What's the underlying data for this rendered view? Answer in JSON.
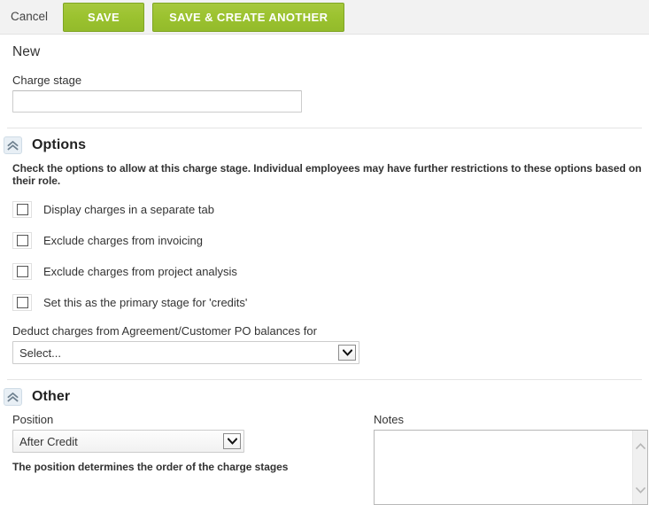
{
  "toolbar": {
    "cancel_label": "Cancel",
    "save_label": "SAVE",
    "save_create_another_label": "SAVE & CREATE ANOTHER",
    "accent_green": "#9dc437",
    "background": "#f2f2f2"
  },
  "page": {
    "title": "New"
  },
  "charge_stage": {
    "label": "Charge stage",
    "value": "",
    "placeholder": ""
  },
  "options_section": {
    "title": "Options",
    "collapse_icon": "double-chevron-up-icon",
    "description": "Check the options to allow at this charge stage. Individual employees may have further restrictions to these options based on their role.",
    "checkboxes": [
      {
        "label": "Display charges in a separate tab",
        "checked": false
      },
      {
        "label": "Exclude charges from invoicing",
        "checked": false
      },
      {
        "label": "Exclude charges from project analysis",
        "checked": false
      },
      {
        "label": "Set this as the primary stage for 'credits'",
        "checked": false
      }
    ],
    "deduct": {
      "label": "Deduct charges from Agreement/Customer PO balances for",
      "value": "Select...",
      "arrow_icon": "chevron-down-icon"
    }
  },
  "other_section": {
    "title": "Other",
    "collapse_icon": "double-chevron-up-icon",
    "position": {
      "label": "Position",
      "value": "After Credit",
      "arrow_icon": "chevron-down-icon",
      "hint": "The position determines the order of the charge stages"
    },
    "notes": {
      "label": "Notes",
      "value": "",
      "placeholder": "",
      "scroll_up_icon": "chevron-up-icon",
      "scroll_down_icon": "chevron-down-icon"
    }
  }
}
